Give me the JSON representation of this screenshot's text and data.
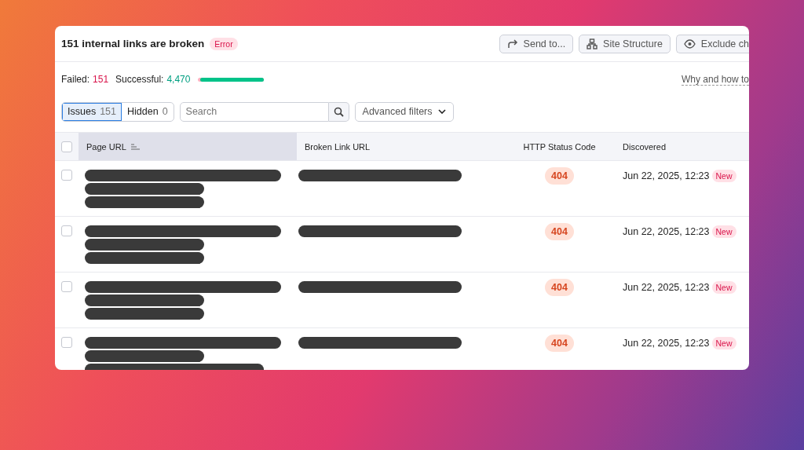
{
  "header": {
    "title": "151 internal links are broken",
    "badge": "Error",
    "actions": [
      {
        "kind": "share",
        "label": "Send to..."
      },
      {
        "kind": "structure",
        "label": "Site Structure"
      },
      {
        "kind": "eye",
        "label": "Exclude ch"
      }
    ]
  },
  "stats": {
    "failed_label": "Failed:",
    "failed_value": "151",
    "successful_label": "Successful:",
    "successful_value": "4,470",
    "level": 0.97,
    "help_link": "Why and how to"
  },
  "tabs": [
    {
      "label": "Issues",
      "count": "151",
      "selected": true
    },
    {
      "label": "Hidden",
      "count": "0",
      "selected": false
    }
  ],
  "search": {
    "placeholder": "Search"
  },
  "filter": {
    "label": "Advanced filters"
  },
  "table": {
    "select_all": {
      "checked": false
    },
    "columns": [
      "Page URL",
      "Broken Link URL",
      "HTTP Status Code",
      "Discovered"
    ],
    "rows": [
      {
        "checked": false,
        "status": "404",
        "discovered": "Jun 22, 2025, 12:23",
        "tag": "New"
      },
      {
        "checked": false,
        "status": "404",
        "discovered": "Jun 22, 2025, 12:23",
        "tag": "New"
      },
      {
        "checked": false,
        "status": "404",
        "discovered": "Jun 22, 2025, 12:23",
        "tag": "New"
      },
      {
        "checked": false,
        "status": "404",
        "discovered": "Jun 22, 2025, 12:23",
        "tag": "New"
      }
    ]
  }
}
